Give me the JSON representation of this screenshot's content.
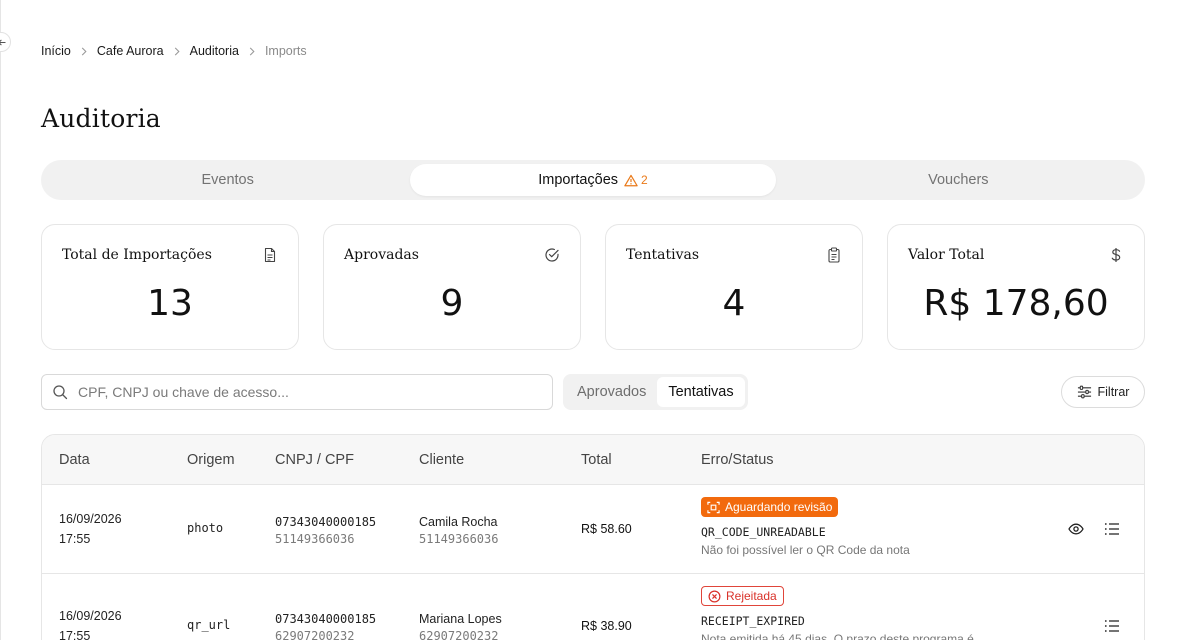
{
  "breadcrumb": [
    "Início",
    "Cafe Aurora",
    "Auditoria",
    "Imports"
  ],
  "page": {
    "title": "Auditoria"
  },
  "tabs": [
    {
      "label": "Eventos",
      "active": false
    },
    {
      "label": "Importações",
      "active": true,
      "warning_count": "2"
    },
    {
      "label": "Vouchers",
      "active": false
    }
  ],
  "stats": [
    {
      "label": "Total de Importações",
      "value": "13",
      "icon": "file-text-icon"
    },
    {
      "label": "Aprovadas",
      "value": "9",
      "icon": "check-circle-icon"
    },
    {
      "label": "Tentativas",
      "value": "4",
      "icon": "clipboard-icon"
    },
    {
      "label": "Valor Total",
      "value": "R$ 178,60",
      "icon": "dollar-icon"
    }
  ],
  "search": {
    "placeholder": "CPF, CNPJ ou chave de acesso...",
    "value": ""
  },
  "segment": {
    "options": [
      "Aprovados",
      "Tentativas"
    ],
    "selected": "Tentativas"
  },
  "filter": {
    "label": "Filtrar"
  },
  "table": {
    "columns": [
      "Data",
      "Origem",
      "CNPJ / CPF",
      "Cliente",
      "Total",
      "Erro/Status"
    ],
    "rows": [
      {
        "date": "16/09/2026",
        "time": "17:55",
        "origin": "photo",
        "cnpj": "07343040000185",
        "cpf": "51149366036",
        "client_name": "Camila Rocha",
        "client_doc": "51149366036",
        "total": "R$ 58.60",
        "status": "Aguardando revisão",
        "status_kind": "pending",
        "error_code": "QR_CODE_UNREADABLE",
        "error_msg": "Não foi possível ler o QR Code da nota"
      },
      {
        "date": "16/09/2026",
        "time": "17:55",
        "origin": "qr_url",
        "cnpj": "07343040000185",
        "cpf": "62907200232",
        "client_name": "Mariana Lopes",
        "client_doc": "62907200232",
        "total": "R$ 38.90",
        "status": "Rejeitada",
        "status_kind": "rejected",
        "error_code": "RECEIPT_EXPIRED",
        "error_msg": "Nota emitida há 45 dias. O prazo deste programa é"
      }
    ]
  },
  "colors": {
    "accent_orange": "#f26a0d",
    "reject_red": "#d9322a",
    "warning": "#ea7a1a"
  }
}
